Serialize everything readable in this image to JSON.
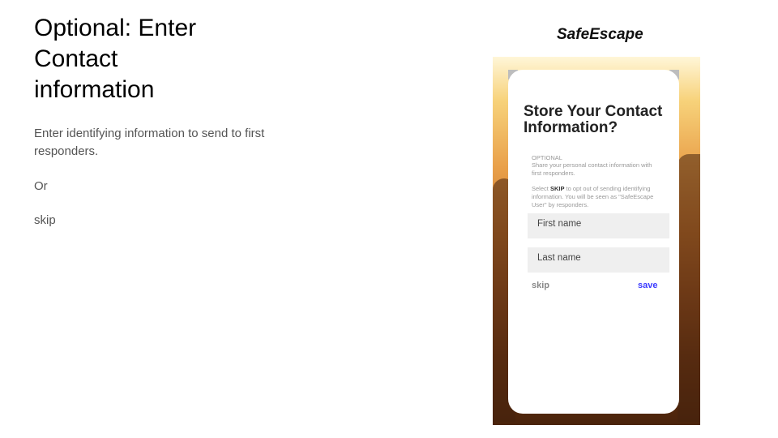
{
  "slide": {
    "title": "Optional: Enter Contact information",
    "description": "Enter identifying information to send to first responders.",
    "or_text": "Or",
    "skip_text": "skip"
  },
  "app": {
    "brand": "SafeEscape",
    "heading": "Store Your Contact Information?",
    "optional_label": "OPTIONAL",
    "share_text": "Share your personal contact information with first responders.",
    "skip_note_prefix": "Select ",
    "skip_note_bold": "SKIP",
    "skip_note_suffix": " to opt out of sending identifying information. You will be seen as \"SafeEscape User\" by responders.",
    "first_name_placeholder": "First name",
    "last_name_placeholder": "Last name",
    "skip_label": "skip",
    "save_label": "save",
    "accent_color": "#3b3bff"
  }
}
